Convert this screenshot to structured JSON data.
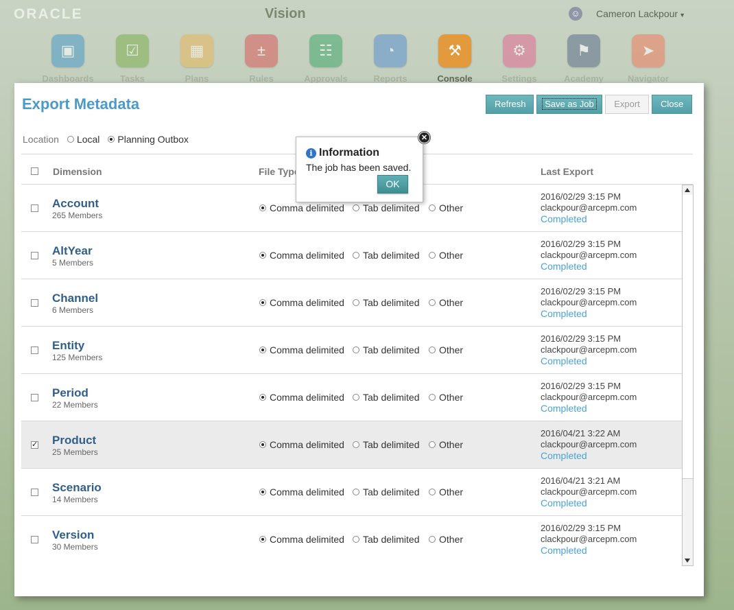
{
  "topbar": {
    "brand": "ORACLE",
    "app_title": "Vision",
    "user_name": "Cameron Lackpour",
    "tiles": [
      {
        "label": "Dashboards",
        "icon": "dashboards-icon",
        "color": "#4a9bc9",
        "active": false
      },
      {
        "label": "Tasks",
        "icon": "tasks-icon",
        "color": "#7fae4e",
        "active": false
      },
      {
        "label": "Plans",
        "icon": "plans-icon",
        "color": "#e7b75a",
        "active": false
      },
      {
        "label": "Rules",
        "icon": "rules-icon",
        "color": "#d95a5a",
        "active": false
      },
      {
        "label": "Approvals",
        "icon": "approvals-icon",
        "color": "#44a86c",
        "active": false
      },
      {
        "label": "Reports",
        "icon": "reports-icon",
        "color": "#5a93cf",
        "active": false
      },
      {
        "label": "Console",
        "icon": "console-icon",
        "color": "#e39a3d",
        "active": true
      },
      {
        "label": "Settings",
        "icon": "settings-icon",
        "color": "#e06a93",
        "active": false
      },
      {
        "label": "Academy",
        "icon": "academy-icon",
        "color": "#5c6f8c",
        "active": false
      },
      {
        "label": "Navigator",
        "icon": "navigator-icon",
        "color": "#ef7c5e",
        "active": false
      }
    ]
  },
  "dialog": {
    "title": "Export Metadata",
    "buttons": {
      "refresh": "Refresh",
      "save_as_job": "Save as Job",
      "export": "Export",
      "close": "Close"
    },
    "location": {
      "label": "Location",
      "options": [
        "Local",
        "Planning Outbox"
      ],
      "selected": "Planning Outbox"
    },
    "columns": {
      "dimension": "Dimension",
      "file_type": "File Type",
      "last_export": "Last Export"
    },
    "file_type_options": [
      "Comma delimited",
      "Tab delimited",
      "Other"
    ],
    "rows": [
      {
        "name": "Account",
        "members": "265 Members",
        "checked": false,
        "file_type": "Comma delimited",
        "date": "2016/02/29 3:15 PM",
        "user": "clackpour@arcepm.com",
        "status": "Completed"
      },
      {
        "name": "AltYear",
        "members": "5 Members",
        "checked": false,
        "file_type": "Comma delimited",
        "date": "2016/02/29 3:15 PM",
        "user": "clackpour@arcepm.com",
        "status": "Completed"
      },
      {
        "name": "Channel",
        "members": "6 Members",
        "checked": false,
        "file_type": "Comma delimited",
        "date": "2016/02/29 3:15 PM",
        "user": "clackpour@arcepm.com",
        "status": "Completed"
      },
      {
        "name": "Entity",
        "members": "125 Members",
        "checked": false,
        "file_type": "Comma delimited",
        "date": "2016/02/29 3:15 PM",
        "user": "clackpour@arcepm.com",
        "status": "Completed"
      },
      {
        "name": "Period",
        "members": "22 Members",
        "checked": false,
        "file_type": "Comma delimited",
        "date": "2016/02/29 3:15 PM",
        "user": "clackpour@arcepm.com",
        "status": "Completed"
      },
      {
        "name": "Product",
        "members": "25 Members",
        "checked": true,
        "file_type": "Comma delimited",
        "date": "2016/04/21 3:22 AM",
        "user": "clackpour@arcepm.com",
        "status": "Completed"
      },
      {
        "name": "Scenario",
        "members": "14 Members",
        "checked": false,
        "file_type": "Comma delimited",
        "date": "2016/04/21 3:21 AM",
        "user": "clackpour@arcepm.com",
        "status": "Completed"
      },
      {
        "name": "Version",
        "members": "30 Members",
        "checked": false,
        "file_type": "Comma delimited",
        "date": "2016/02/29 3:15 PM",
        "user": "clackpour@arcepm.com",
        "status": "Completed"
      }
    ]
  },
  "popup": {
    "title": "Information",
    "message": "The job has been saved.",
    "ok_label": "OK"
  }
}
